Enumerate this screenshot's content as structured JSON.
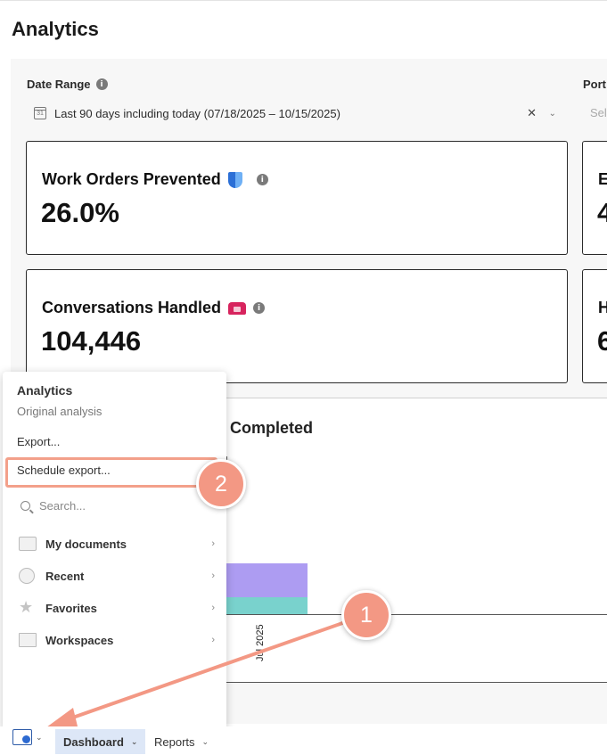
{
  "page": {
    "title": "Analytics"
  },
  "filters": {
    "date_range_label": "Date Range",
    "date_range_value": "Last 90 days including today (07/18/2025 – 10/15/2025)",
    "portfolio_label_partial": "Port",
    "portfolio_placeholder_partial": "Sel"
  },
  "kpis": [
    {
      "title": "Work Orders Prevented",
      "value": "26.0%",
      "icon": "shield-icon"
    },
    {
      "title": "Conversations Handled",
      "value": "104,446",
      "icon": "phone-icon"
    }
  ],
  "kpi_partials": {
    "top_title": "E",
    "top_value": "4",
    "bottom_title": "H",
    "bottom_value": "6"
  },
  "chart": {
    "title_partial": "Completed",
    "chart_data": {
      "type": "bar",
      "categories": [
        "Jul 2025"
      ],
      "series": [
        {
          "color": "#79d2cd",
          "values": [
            1
          ]
        },
        {
          "color": "#ad9cf2",
          "values": [
            2
          ]
        }
      ]
    }
  },
  "menu": {
    "header": "Analytics",
    "subheader": "Original analysis",
    "export": "Export...",
    "schedule_export": "Schedule export...",
    "search_placeholder": "Search...",
    "nav": [
      {
        "label": "My documents",
        "icon": "folder-icon"
      },
      {
        "label": "Recent",
        "icon": "clock-icon"
      },
      {
        "label": "Favorites",
        "icon": "star-icon"
      },
      {
        "label": "Workspaces",
        "icon": "monitor-icon"
      }
    ]
  },
  "annotations": {
    "step1": "1",
    "step2": "2",
    "accent": "#f39884"
  },
  "bottom_tabs": {
    "dashboard": "Dashboard",
    "reports": "Reports"
  }
}
